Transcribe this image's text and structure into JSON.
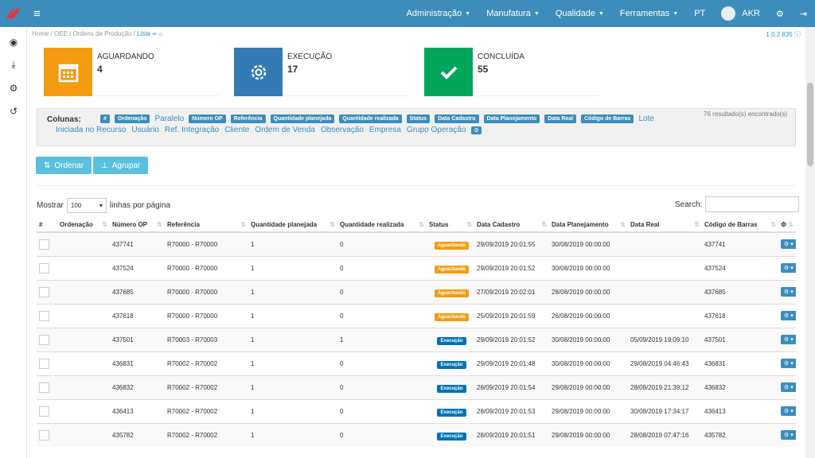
{
  "header": {
    "menu": [
      {
        "label": "Administração"
      },
      {
        "label": "Manufatura"
      },
      {
        "label": "Qualidade"
      },
      {
        "label": "Ferramentas"
      }
    ],
    "language": "PT",
    "user": "AKR"
  },
  "breadcrumb": {
    "home": "Home",
    "oee": "OEE",
    "ordens": "Ordens de Produção",
    "lista": "Lista",
    "version": "1.0.2.835"
  },
  "cards": [
    {
      "label": "AGUARDANDO",
      "value": "4",
      "color": "#f39c12"
    },
    {
      "label": "EXECUÇÃO",
      "value": "17",
      "color": "#337ab7"
    },
    {
      "label": "CONCLUÍDA",
      "value": "55",
      "color": "#00a65a"
    }
  ],
  "columns_panel": {
    "title": "Colunas:",
    "results": "76 resultado(s) encontrado(s)",
    "line1": [
      {
        "label": "#",
        "active": true
      },
      {
        "label": "Ordenação",
        "active": true
      },
      {
        "label": "Paralelo",
        "active": false
      },
      {
        "label": "Número OP",
        "active": true
      },
      {
        "label": "Referência",
        "active": true
      },
      {
        "label": "Quantidade planejada",
        "active": true
      },
      {
        "label": "Quantidade realizada",
        "active": true
      },
      {
        "label": "Status",
        "active": true
      },
      {
        "label": "Data Cadastro",
        "active": true
      },
      {
        "label": "Data Planejamento",
        "active": true
      },
      {
        "label": "Data Real",
        "active": true
      },
      {
        "label": "Código de Barras",
        "active": true
      },
      {
        "label": "Lote",
        "active": false
      }
    ],
    "line2": [
      {
        "label": "Iniciada no Recurso"
      },
      {
        "label": "Usuário"
      },
      {
        "label": "Ref. Integração"
      },
      {
        "label": "Cliente"
      },
      {
        "label": "Ordem de Venda"
      },
      {
        "label": "Observação"
      },
      {
        "label": "Empresa"
      },
      {
        "label": "Grupo Operação"
      }
    ]
  },
  "buttons": {
    "order": "Ordenar",
    "group": "Agrupar"
  },
  "table_controls": {
    "show_label": "Mostrar",
    "page_size": "100",
    "per_page_label": "linhas por página",
    "search_label": "Search:"
  },
  "table": {
    "headers": [
      "#",
      "Ordenação",
      "Número OP",
      "Referência",
      "Quantidade planejada",
      "Quantidade realizada",
      "Status",
      "Data Cadastro",
      "Data Planejamento",
      "Data Real",
      "Código de Barras",
      ""
    ],
    "rows": [
      {
        "op": "437741",
        "ref": "R70000 - R70000",
        "qp": "1",
        "qr": "0",
        "status": "Aguardando",
        "cad": "29/09/2019 20:01:55",
        "plan": "30/08/2019 00:00:00",
        "real": "",
        "barcode": "437741"
      },
      {
        "op": "437524",
        "ref": "R70000 - R70000",
        "qp": "1",
        "qr": "0",
        "status": "Aguardando",
        "cad": "29/09/2019 20:01:52",
        "plan": "30/08/2019 00:00:00",
        "real": "",
        "barcode": "437524"
      },
      {
        "op": "437685",
        "ref": "R70000 - R70000",
        "qp": "1",
        "qr": "0",
        "status": "Aguardando",
        "cad": "27/09/2019 20:02:01",
        "plan": "28/08/2019 00:00:00",
        "real": "",
        "barcode": "437685"
      },
      {
        "op": "437618",
        "ref": "R70000 - R70000",
        "qp": "1",
        "qr": "0",
        "status": "Aguardando",
        "cad": "25/09/2019 20:01:59",
        "plan": "26/08/2019 00:00:00",
        "real": "",
        "barcode": "437618"
      },
      {
        "op": "437501",
        "ref": "R70003 - R70003",
        "qp": "1",
        "qr": "1",
        "status": "Execução",
        "cad": "29/09/2019 20:01:52",
        "plan": "30/08/2019 00:00:00",
        "real": "05/09/2019 19:09:10",
        "barcode": "437501"
      },
      {
        "op": "436831",
        "ref": "R70002 - R70002",
        "qp": "1",
        "qr": "0",
        "status": "Execução",
        "cad": "29/09/2019 20:01:48",
        "plan": "30/08/2019 00:00:00",
        "real": "29/08/2019 04:46:43",
        "barcode": "436831"
      },
      {
        "op": "436832",
        "ref": "R70002 - R70002",
        "qp": "1",
        "qr": "0",
        "status": "Execução",
        "cad": "28/09/2019 20:01:54",
        "plan": "29/08/2019 00:00:00",
        "real": "28/08/2019 21:39:12",
        "barcode": "436832"
      },
      {
        "op": "436413",
        "ref": "R70002 - R70002",
        "qp": "1",
        "qr": "0",
        "status": "Execução",
        "cad": "28/09/2019 20:01:53",
        "plan": "29/08/2019 00:00:00",
        "real": "30/08/2019 17:34:17",
        "barcode": "436413"
      },
      {
        "op": "435782",
        "ref": "R70002 - R70002",
        "qp": "1",
        "qr": "0",
        "status": "Execução",
        "cad": "28/09/2019 20:01:51",
        "plan": "29/08/2019 00:00:00",
        "real": "28/08/2019 07:47:16",
        "barcode": "435782"
      }
    ]
  }
}
